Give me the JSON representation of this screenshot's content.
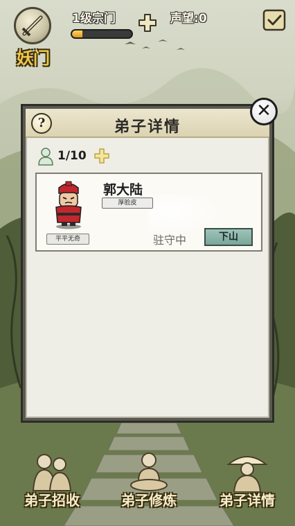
{
  "top_bar": {
    "sect_name": "妖门",
    "level_label": "1级宗门",
    "level_progress": 0.18,
    "reputation_label": "声望",
    "reputation_sep": ":",
    "reputation_value": "0"
  },
  "dialog": {
    "title": "弟子详情",
    "help_symbol": "?",
    "close_symbol": "✕",
    "disciple_count": "1/10",
    "disciples": [
      {
        "name": "郭大陆",
        "trait": "厚脸皮",
        "talent": "平平无奇",
        "status": "驻守中",
        "action_label": "下山"
      }
    ]
  },
  "bottom_menu": {
    "recruit_label": "弟子招收",
    "cultivate_label": "弟子修炼",
    "details_label": "弟子详情"
  },
  "colors": {
    "accent_gold": "#f0c84a",
    "leave_button": "#8fb6aa",
    "progress_fill": "#f0b232"
  }
}
